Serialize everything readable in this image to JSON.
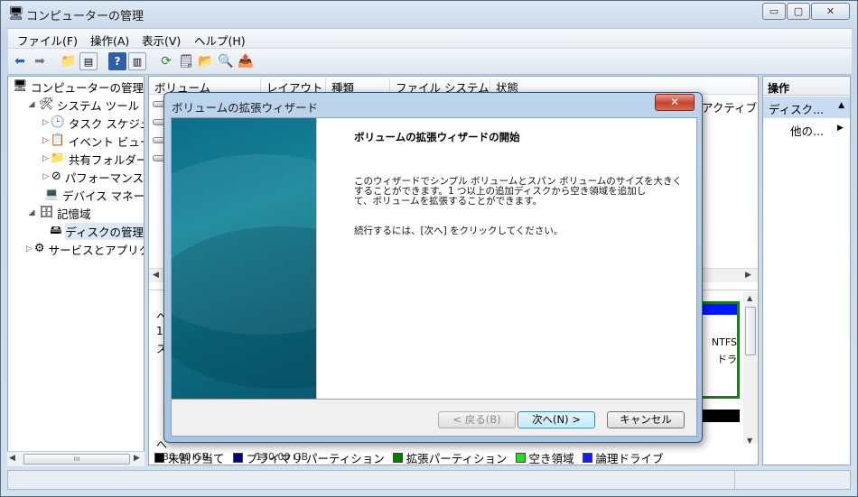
{
  "window": {
    "title": "コンピューターの管理",
    "buttons": {
      "minimize": "▭",
      "maximize": "▢",
      "close": "✕"
    }
  },
  "menu": [
    "ファイル(F)",
    "操作(A)",
    "表示(V)",
    "ヘルプ(H)"
  ],
  "toolbar": {
    "icons": [
      "back-icon",
      "forward-icon",
      "up-folder-icon",
      "show-tree-icon",
      "help-icon",
      "show-action-icon",
      "refresh-icon",
      "properties-icon",
      "open-icon",
      "search-icon",
      "export-icon"
    ]
  },
  "tree": [
    {
      "label": "コンピューターの管理",
      "icon": "🖥",
      "level": 0,
      "exp": ""
    },
    {
      "label": "システム ツール",
      "icon": "🛠",
      "level": 1,
      "exp": "◢"
    },
    {
      "label": "タスク スケジュ",
      "icon": "🕒",
      "level": 2,
      "exp": "▷"
    },
    {
      "label": "イベント ビュー",
      "icon": "📋",
      "level": 2,
      "exp": "▷"
    },
    {
      "label": "共有フォルダー",
      "icon": "📁",
      "level": 2,
      "exp": "▷"
    },
    {
      "label": "パフォーマンス",
      "icon": "⊘",
      "level": 2,
      "exp": "▷"
    },
    {
      "label": "デバイス マネー",
      "icon": "💻",
      "level": 2,
      "exp": ""
    },
    {
      "label": "記憶域",
      "icon": "🗄",
      "level": 1,
      "exp": "◢"
    },
    {
      "label": "ディスクの管理",
      "icon": "🖴",
      "level": 2,
      "exp": "",
      "selected": true
    },
    {
      "label": "サービスとアプリク",
      "icon": "⚙",
      "level": 1,
      "exp": "▷"
    }
  ],
  "columns": [
    "ボリューム",
    "レイアウト",
    "種類",
    "ファイル システム",
    "状態"
  ],
  "center_fragments": {
    "active": "アクティブ",
    "left_letters": [
      "へ",
      "1",
      "ス",
      "へ"
    ],
    "ntfs": "NTFS",
    "dora": "ドラ",
    "size1": "130.00 GB",
    "size2": "130.00 GB"
  },
  "legend": [
    {
      "label": "未割り当て",
      "color": "#000000"
    },
    {
      "label": "プライマリ パーティション",
      "color": "#00008b"
    },
    {
      "label": "拡張パーティション",
      "color": "#008000"
    },
    {
      "label": "空き領域",
      "color": "#22dd22"
    },
    {
      "label": "論理ドライブ",
      "color": "#1a1aff"
    }
  ],
  "actions": {
    "header": "操作",
    "selected": "ディスク...",
    "more": "他の..."
  },
  "dialog": {
    "title": "ボリュームの拡張ウィザード",
    "heading": "ボリュームの拡張ウィザードの開始",
    "paragraph1": [
      "このウィザードでシンプル ボリュームとスパン ボリュームのサイズを大きく",
      "することができます。1 つ以上の追加ディスクから空き領域を追加し",
      "て、ボリュームを拡張することができます。"
    ],
    "paragraph2": "続行するには、[次へ] をクリックしてください。",
    "buttons": {
      "back": "< 戻る(B)",
      "next": "次へ(N) >",
      "cancel": "キャンセル"
    },
    "close": "✕"
  }
}
